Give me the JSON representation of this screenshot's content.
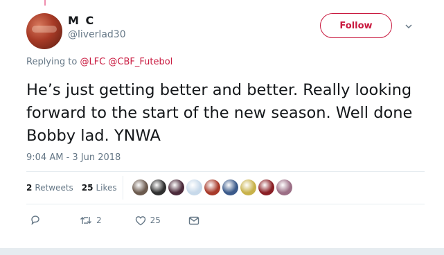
{
  "tweet": {
    "author_name": "M C",
    "author_handle": "@liverlad30",
    "follow_label": "Follow",
    "replying_prefix": "Replying to",
    "replying_to": [
      "@LFC",
      "@CBF_Futebol"
    ],
    "text": "He’s just getting better and better. Really looking forward to the start of the new season. Well done Bobby lad. YNWA",
    "timestamp": "9:04 AM - 3 Jun 2018",
    "retweets_count": "2",
    "retweets_label": "Retweets",
    "likes_count": "25",
    "likes_label": "Likes",
    "actions": {
      "reply_count": "",
      "retweet_count": "2",
      "like_count": "25"
    }
  },
  "colors": {
    "accent": "#c9193f",
    "muted": "#657786",
    "text": "#14171a",
    "divider": "#e6ecf0"
  },
  "liker_avatars": [
    {
      "name": "liker-avatar",
      "color": "#6b5a4e"
    },
    {
      "name": "liker-avatar",
      "color": "#2f2f2f"
    },
    {
      "name": "liker-avatar",
      "color": "#4b2a3a"
    },
    {
      "name": "liker-avatar",
      "color": "#c7d9ea"
    },
    {
      "name": "liker-avatar",
      "color": "#a83a2a"
    },
    {
      "name": "liker-avatar",
      "color": "#3b5a8a"
    },
    {
      "name": "liker-avatar",
      "color": "#c8b24a"
    },
    {
      "name": "liker-avatar",
      "color": "#8a1f25"
    },
    {
      "name": "liker-avatar",
      "color": "#9c6f86"
    }
  ]
}
